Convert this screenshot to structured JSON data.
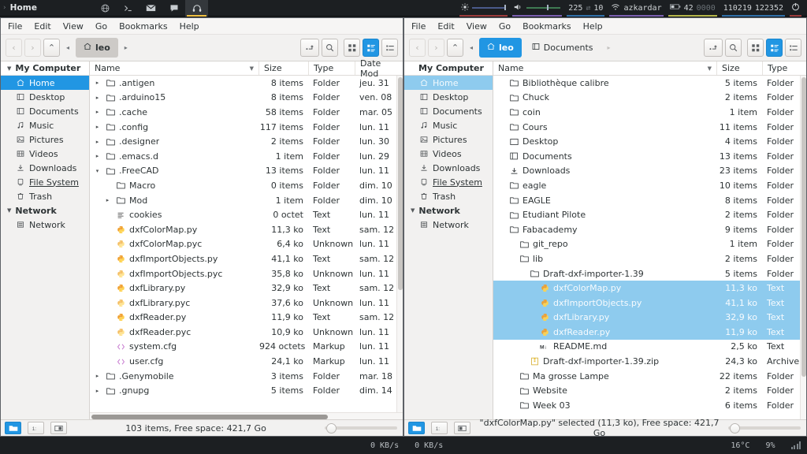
{
  "taskbar": {
    "workspace_chevron": "›",
    "window_title": "Home",
    "tray_icons": [
      {
        "name": "globe-icon",
        "glyph": "⊕"
      },
      {
        "name": "terminal-icon",
        "glyph": "❯_"
      },
      {
        "name": "mail-icon",
        "glyph": "✉"
      },
      {
        "name": "chat-icon",
        "glyph": "὞8"
      },
      {
        "name": "headphones-icon",
        "glyph": "Ω"
      }
    ],
    "brightness_icon": "☀",
    "volume_icon": "🔊",
    "cpu_reading": "225",
    "cpu_swap_icon": "⇄",
    "mem_reading": "10",
    "wifi_icon": "◔",
    "wifi_ssid": "azkardar",
    "battery_icon": "▭",
    "battery_percent": "42",
    "battery_extra": "0000",
    "date_reading": "110219",
    "time_reading": "122352",
    "power_icon": "⏻"
  },
  "bottombar": {
    "net_down": "0 KB/s",
    "net_up": "0 KB/s",
    "temperature": "16°C",
    "cpu_percent": "9%",
    "signal_icon": "signal-bars"
  },
  "menu": [
    "File",
    "Edit",
    "View",
    "Go",
    "Bookmarks",
    "Help"
  ],
  "toolbar": {
    "back_icon": "‹",
    "forward_icon": "›",
    "up_icon": "⌃",
    "crumb_prev_icon": "◂",
    "crumb_next_icon": "▸",
    "home_icon": "⌂",
    "path_entry_icon": "↵",
    "search_icon": "⚲",
    "view_icons_icon": "▦",
    "view_details_icon": "▤",
    "view_compact_icon": "≣"
  },
  "sidebar": {
    "groups": [
      {
        "label": "My Computer",
        "items": [
          {
            "label": "Home",
            "icon": "home-icon",
            "glyph": "⌂",
            "selected": true
          },
          {
            "label": "Desktop",
            "icon": "desktop-icon",
            "glyph": "◱"
          },
          {
            "label": "Documents",
            "icon": "documents-icon",
            "glyph": "◱"
          },
          {
            "label": "Music",
            "icon": "music-icon",
            "glyph": "♫"
          },
          {
            "label": "Pictures",
            "icon": "pictures-icon",
            "glyph": "▣"
          },
          {
            "label": "Videos",
            "icon": "videos-icon",
            "glyph": "▥"
          },
          {
            "label": "Downloads",
            "icon": "downloads-icon",
            "glyph": "⤓"
          },
          {
            "label": "File System",
            "icon": "filesystem-icon",
            "glyph": "▯",
            "underline": true
          },
          {
            "label": "Trash",
            "icon": "trash-icon",
            "glyph": "⌧"
          }
        ]
      },
      {
        "label": "Network",
        "items": [
          {
            "label": "Network",
            "icon": "network-icon",
            "glyph": "☰"
          }
        ]
      }
    ]
  },
  "left_window": {
    "breadcrumbs": [
      {
        "label": "leo",
        "icon": "home-icon",
        "selected": true
      }
    ],
    "columns": [
      "Name",
      "Size",
      "Type",
      "Date Mod"
    ],
    "rows": [
      {
        "name": ".antigen",
        "size": "8 items",
        "type": "Folder",
        "date": "jeu. 31",
        "icon": "folder",
        "expander": "▸",
        "indent": 0
      },
      {
        "name": ".arduino15",
        "size": "8 items",
        "type": "Folder",
        "date": "ven. 08",
        "icon": "folder",
        "expander": "▸",
        "indent": 0
      },
      {
        "name": ".cache",
        "size": "58 items",
        "type": "Folder",
        "date": "mar. 05",
        "icon": "folder",
        "expander": "▸",
        "indent": 0
      },
      {
        "name": ".config",
        "size": "117 items",
        "type": "Folder",
        "date": "lun. 11",
        "icon": "folder",
        "expander": "▸",
        "indent": 0
      },
      {
        "name": ".designer",
        "size": "2 items",
        "type": "Folder",
        "date": "lun. 30",
        "icon": "folder",
        "expander": "▸",
        "indent": 0
      },
      {
        "name": ".emacs.d",
        "size": "1 item",
        "type": "Folder",
        "date": "lun. 29",
        "icon": "folder",
        "expander": "▸",
        "indent": 0
      },
      {
        "name": ".FreeCAD",
        "size": "13 items",
        "type": "Folder",
        "date": "lun. 11",
        "icon": "folder",
        "expander": "▾",
        "indent": 0
      },
      {
        "name": "Macro",
        "size": "0 items",
        "type": "Folder",
        "date": "dim. 10",
        "icon": "folder",
        "expander": "",
        "indent": 1
      },
      {
        "name": "Mod",
        "size": "1 item",
        "type": "Folder",
        "date": "dim. 10",
        "icon": "folder",
        "expander": "▸",
        "indent": 1
      },
      {
        "name": "cookies",
        "size": "0 octet",
        "type": "Text",
        "date": "lun. 11",
        "icon": "txt",
        "expander": "",
        "indent": 1
      },
      {
        "name": "dxfColorMap.py",
        "size": "11,3 ko",
        "type": "Text",
        "date": "sam. 12",
        "icon": "py",
        "expander": "",
        "indent": 1
      },
      {
        "name": "dxfColorMap.pyc",
        "size": "6,4 ko",
        "type": "Unknown",
        "date": "lun. 11",
        "icon": "pyc",
        "expander": "",
        "indent": 1
      },
      {
        "name": "dxfImportObjects.py",
        "size": "41,1 ko",
        "type": "Text",
        "date": "sam. 12",
        "icon": "py",
        "expander": "",
        "indent": 1
      },
      {
        "name": "dxfImportObjects.pyc",
        "size": "35,8 ko",
        "type": "Unknown",
        "date": "lun. 11",
        "icon": "pyc",
        "expander": "",
        "indent": 1
      },
      {
        "name": "dxfLibrary.py",
        "size": "32,9 ko",
        "type": "Text",
        "date": "sam. 12",
        "icon": "py",
        "expander": "",
        "indent": 1
      },
      {
        "name": "dxfLibrary.pyc",
        "size": "37,6 ko",
        "type": "Unknown",
        "date": "lun. 11",
        "icon": "pyc",
        "expander": "",
        "indent": 1
      },
      {
        "name": "dxfReader.py",
        "size": "11,9 ko",
        "type": "Text",
        "date": "sam. 12",
        "icon": "py",
        "expander": "",
        "indent": 1
      },
      {
        "name": "dxfReader.pyc",
        "size": "10,9 ko",
        "type": "Unknown",
        "date": "lun. 11",
        "icon": "pyc",
        "expander": "",
        "indent": 1
      },
      {
        "name": "system.cfg",
        "size": "924 octets",
        "type": "Markup",
        "date": "lun. 11",
        "icon": "cfg",
        "expander": "",
        "indent": 1
      },
      {
        "name": "user.cfg",
        "size": "24,1 ko",
        "type": "Markup",
        "date": "lun. 11",
        "icon": "cfg",
        "expander": "",
        "indent": 1
      },
      {
        "name": ".Genymobile",
        "size": "3 items",
        "type": "Folder",
        "date": "mar. 18",
        "icon": "folder",
        "expander": "▸",
        "indent": 0
      },
      {
        "name": ".gnupg",
        "size": "5 items",
        "type": "Folder",
        "date": "dim. 14",
        "icon": "folder",
        "expander": "▸",
        "indent": 0
      }
    ],
    "status": "103 items, Free space: 421,7 Go"
  },
  "right_window": {
    "breadcrumbs": [
      {
        "label": "leo",
        "icon": "home-icon",
        "selected": true
      },
      {
        "label": "Documents",
        "icon": "documents-icon",
        "selected": false
      }
    ],
    "columns": [
      "Name",
      "Size",
      "Type"
    ],
    "rows": [
      {
        "name": "Bibliothèque calibre",
        "size": "5 items",
        "type": "Folder",
        "icon": "folder",
        "indent": 0
      },
      {
        "name": "Chuck",
        "size": "2 items",
        "type": "Folder",
        "icon": "folder",
        "indent": 0
      },
      {
        "name": "coin",
        "size": "1 item",
        "type": "Folder",
        "icon": "folder",
        "indent": 0
      },
      {
        "name": "Cours",
        "size": "11 items",
        "type": "Folder",
        "icon": "folder",
        "indent": 0
      },
      {
        "name": "Desktop",
        "size": "4 items",
        "type": "Folder",
        "icon": "desktop",
        "indent": 0
      },
      {
        "name": "Documents",
        "size": "13 items",
        "type": "Folder",
        "icon": "documents",
        "indent": 0
      },
      {
        "name": "Downloads",
        "size": "23 items",
        "type": "Folder",
        "icon": "downloads",
        "indent": 0
      },
      {
        "name": "eagle",
        "size": "10 items",
        "type": "Folder",
        "icon": "folder",
        "indent": 0
      },
      {
        "name": "EAGLE",
        "size": "8 items",
        "type": "Folder",
        "icon": "folder",
        "indent": 0
      },
      {
        "name": "Etudiant Pilote",
        "size": "2 items",
        "type": "Folder",
        "icon": "folder",
        "indent": 0
      },
      {
        "name": "Fabacademy",
        "size": "9 items",
        "type": "Folder",
        "icon": "folder",
        "indent": 0
      },
      {
        "name": "git_repo",
        "size": "1 item",
        "type": "Folder",
        "icon": "folder",
        "indent": 1
      },
      {
        "name": "lib",
        "size": "2 items",
        "type": "Folder",
        "icon": "folder",
        "indent": 1
      },
      {
        "name": "Draft-dxf-importer-1.39",
        "size": "5 items",
        "type": "Folder",
        "icon": "folder",
        "indent": 2
      },
      {
        "name": "dxfColorMap.py",
        "size": "11,3 ko",
        "type": "Text",
        "icon": "py",
        "indent": 3,
        "selected": true
      },
      {
        "name": "dxfImportObjects.py",
        "size": "41,1 ko",
        "type": "Text",
        "icon": "py",
        "indent": 3,
        "selected": true
      },
      {
        "name": "dxfLibrary.py",
        "size": "32,9 ko",
        "type": "Text",
        "icon": "py",
        "indent": 3,
        "selected": true
      },
      {
        "name": "dxfReader.py",
        "size": "11,9 ko",
        "type": "Text",
        "icon": "py",
        "indent": 3,
        "selected": true
      },
      {
        "name": "README.md",
        "size": "2,5 ko",
        "type": "Text",
        "icon": "md",
        "indent": 3
      },
      {
        "name": "Draft-dxf-importer-1.39.zip",
        "size": "24,3 ko",
        "type": "Archive",
        "icon": "zip",
        "indent": 2
      },
      {
        "name": "Ma grosse Lampe",
        "size": "22 items",
        "type": "Folder",
        "icon": "folder",
        "indent": 1
      },
      {
        "name": "Website",
        "size": "2 items",
        "type": "Folder",
        "icon": "folder",
        "indent": 1
      },
      {
        "name": "Week 03",
        "size": "6 items",
        "type": "Folder",
        "icon": "folder",
        "indent": 1
      }
    ],
    "status": "\"dxfColorMap.py\" selected (11,3 ko), Free space: 421,7 Go"
  },
  "statusbar_buttons": {
    "open_icon": "▰",
    "scale_icon": "1∶",
    "pane_icon": "▣"
  },
  "colors": {
    "accent": "#2196e3",
    "accent_unfocused": "#8ecbee",
    "taskbar_bg": "#1c1f22",
    "window_bg": "#f2f1f0"
  }
}
